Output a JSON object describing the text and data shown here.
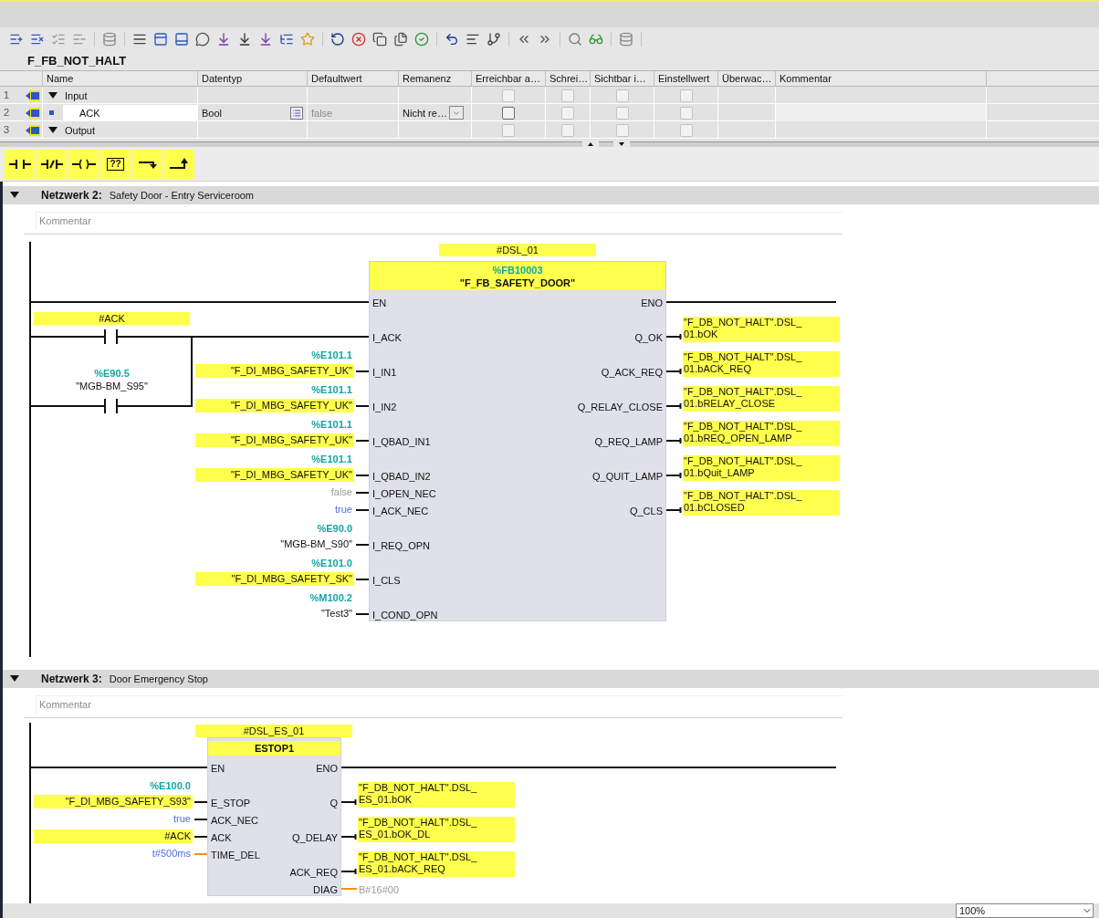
{
  "block_title": "F_FB_NOT_HALT",
  "interface": {
    "columns": [
      "Name",
      "Datentyp",
      "Defaultwert",
      "Remanenz",
      "Erreichbar a…",
      "Schrei…",
      "Sichtbar i…",
      "Einstellwert",
      "Überwac…",
      "Kommentar"
    ],
    "rows": [
      {
        "number": "1",
        "kind": "section",
        "name": "Input",
        "expanded": true,
        "checks": [
          {
            "checked": false,
            "disabled": true
          },
          {
            "checked": false,
            "disabled": true
          },
          {
            "checked": false,
            "disabled": true
          },
          {
            "checked": false,
            "disabled": true
          }
        ]
      },
      {
        "number": "2",
        "kind": "variable",
        "name": "ACK",
        "datatype": "Bool",
        "default": "false",
        "retain": "Nicht re…",
        "checks": [
          {
            "checked": false,
            "disabled": false
          },
          {
            "checked": false,
            "disabled": true
          },
          {
            "checked": false,
            "disabled": true
          },
          {
            "checked": false,
            "disabled": true
          }
        ]
      },
      {
        "number": "3",
        "kind": "section",
        "name": "Output",
        "expanded": true,
        "checks": [
          {
            "checked": false,
            "disabled": true
          },
          {
            "checked": false,
            "disabled": true
          },
          {
            "checked": false,
            "disabled": true
          },
          {
            "checked": false,
            "disabled": true
          }
        ]
      }
    ]
  },
  "ladder_tools": [
    {
      "kind": "no_contact"
    },
    {
      "kind": "nc_contact"
    },
    {
      "kind": "coil"
    },
    {
      "kind": "empty_box",
      "label": "??"
    },
    {
      "kind": "open_branch"
    },
    {
      "kind": "close_branch"
    }
  ],
  "networks": [
    {
      "title": "Netzwerk 2:",
      "description": "Safety Door -  Entry Serviceroom",
      "expanded": true,
      "comment": {
        "placeholder": "Kommentar"
      },
      "contacts": [
        {
          "operand": "#ACK",
          "highlighted": true
        },
        {
          "address": "%E90.5",
          "operand": "\"MGB-BM_S95\"",
          "highlighted": false
        }
      ],
      "block": {
        "instance": "#DSL_01",
        "address": "%FB10003",
        "name": "\"F_FB_SAFETY_DOOR\"",
        "en": "EN",
        "eno": "ENO",
        "inputs": [
          {
            "pin": "I_ACK",
            "kind": "wire"
          },
          {
            "pin": "I_IN1",
            "kind": "tag",
            "address": "%E101.1",
            "operand": "\"F_DI_MBG_SAFETY_UK\"",
            "highlighted": true,
            "bool": true
          },
          {
            "pin": "I_IN2",
            "kind": "tag",
            "address": "%E101.1",
            "operand": "\"F_DI_MBG_SAFETY_UK\"",
            "highlighted": true,
            "bool": true
          },
          {
            "pin": "I_QBAD_IN1",
            "kind": "tag",
            "address": "%E101.1",
            "operand": "\"F_DI_MBG_SAFETY_UK\"",
            "highlighted": true,
            "bool": true
          },
          {
            "pin": "I_QBAD_IN2",
            "kind": "tag",
            "address": "%E101.1",
            "operand": "\"F_DI_MBG_SAFETY_UK\"",
            "highlighted": true,
            "bool": true
          },
          {
            "pin": "I_OPEN_NEC",
            "kind": "default",
            "operand": "false",
            "bool": true
          },
          {
            "pin": "I_ACK_NEC",
            "kind": "constant",
            "operand": "true",
            "bool": true
          },
          {
            "pin": "I_REQ_OPN",
            "kind": "tag",
            "address": "%E90.0",
            "operand": "\"MGB-BM_S90\"",
            "highlighted": false,
            "bool": true
          },
          {
            "pin": "I_CLS",
            "kind": "tag",
            "address": "%E101.0",
            "operand": "\"F_DI_MBG_SAFETY_SK\"",
            "highlighted": true,
            "bool": true
          },
          {
            "pin": "I_COND_OPN",
            "kind": "tag",
            "address": "%M100.2",
            "operand": "\"Test3\"",
            "highlighted": false,
            "bool": true
          }
        ],
        "outputs": [
          {
            "pin": "Q_OK",
            "kind": "tag",
            "lines": [
              "\"F_DB_NOT_HALT\".DSL_",
              "01.bOK"
            ],
            "highlighted": true,
            "bool": true
          },
          {
            "pin": "Q_ACK_REQ",
            "kind": "tag",
            "lines": [
              "\"F_DB_NOT_HALT\".DSL_",
              "01.bACK_REQ"
            ],
            "highlighted": true,
            "bool": true
          },
          {
            "pin": "Q_RELAY_CLOSE",
            "kind": "tag",
            "lines": [
              "\"F_DB_NOT_HALT\".DSL_",
              "01.bRELAY_CLOSE"
            ],
            "highlighted": true,
            "bool": true
          },
          {
            "pin": "Q_REQ_LAMP",
            "kind": "tag",
            "lines": [
              "\"F_DB_NOT_HALT\".DSL_",
              "01.bREQ_OPEN_LAMP"
            ],
            "highlighted": true,
            "bool": true
          },
          {
            "pin": "Q_QUIT_LAMP",
            "kind": "tag",
            "lines": [
              "\"F_DB_NOT_HALT\".DSL_",
              "01.bQuit_LAMP"
            ],
            "highlighted": true,
            "bool": true
          },
          {
            "pin": "Q_CLS",
            "kind": "tag",
            "lines": [
              "\"F_DB_NOT_HALT\".DSL_",
              "01.bCLOSED"
            ],
            "highlighted": true,
            "bool": true
          }
        ]
      }
    },
    {
      "title": "Netzwerk 3:",
      "description": "Door Emergency Stop",
      "expanded": true,
      "comment": {
        "placeholder": "Kommentar"
      },
      "block": {
        "instance": "#DSL_ES_01",
        "name": "ESTOP1",
        "en": "EN",
        "eno": "ENO",
        "inputs": [
          {
            "pin": "E_STOP",
            "kind": "tag",
            "address": "%E100.0",
            "operand": "\"F_DI_MBG_SAFETY_S93\"",
            "highlighted": true,
            "bool": true
          },
          {
            "pin": "ACK_NEC",
            "kind": "constant",
            "operand": "true",
            "bool": true
          },
          {
            "pin": "ACK",
            "kind": "tag",
            "operand": "#ACK",
            "highlighted": true,
            "bool": true
          },
          {
            "pin": "TIME_DEL",
            "kind": "constant",
            "operand": "t#500ms",
            "bool": false
          }
        ],
        "outputs": [
          {
            "pin": "Q",
            "kind": "tag",
            "lines": [
              "\"F_DB_NOT_HALT\".DSL_",
              "ES_01.bOK"
            ],
            "highlighted": true,
            "bool": true
          },
          {
            "pin": "Q_DELAY",
            "kind": "tag",
            "lines": [
              "\"F_DB_NOT_HALT\".DSL_",
              "ES_01.bOK_DL"
            ],
            "highlighted": true,
            "bool": true
          },
          {
            "pin": "ACK_REQ",
            "kind": "tag",
            "lines": [
              "\"F_DB_NOT_HALT\".DSL_",
              "ES_01.bACK_REQ"
            ],
            "highlighted": true,
            "bool": true
          },
          {
            "pin": "DIAG",
            "kind": "default",
            "operand": "B#16#00",
            "bool": false
          }
        ]
      }
    }
  ],
  "zoom": {
    "value": "100%"
  }
}
